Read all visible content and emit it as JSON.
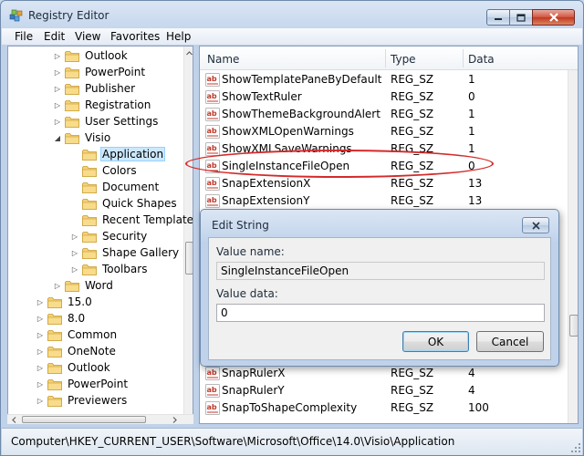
{
  "window": {
    "title": "Registry Editor",
    "controls": {
      "minimize_icon": "minimize-icon",
      "maximize_icon": "maximize-icon",
      "close_icon": "close-icon"
    }
  },
  "menu": [
    "File",
    "Edit",
    "View",
    "Favorites",
    "Help"
  ],
  "tree": {
    "items": [
      {
        "label": "Outlook",
        "depth": 2,
        "expander": "collapsed"
      },
      {
        "label": "PowerPoint",
        "depth": 2,
        "expander": "collapsed"
      },
      {
        "label": "Publisher",
        "depth": 2,
        "expander": "collapsed"
      },
      {
        "label": "Registration",
        "depth": 2,
        "expander": "collapsed"
      },
      {
        "label": "User Settings",
        "depth": 2,
        "expander": "collapsed"
      },
      {
        "label": "Visio",
        "depth": 2,
        "expander": "expanded"
      },
      {
        "label": "Application",
        "depth": 3,
        "expander": "none",
        "selected": true
      },
      {
        "label": "Colors",
        "depth": 3,
        "expander": "none"
      },
      {
        "label": "Document",
        "depth": 3,
        "expander": "none"
      },
      {
        "label": "Quick Shapes",
        "depth": 3,
        "expander": "none"
      },
      {
        "label": "Recent Templates",
        "depth": 3,
        "expander": "none"
      },
      {
        "label": "Security",
        "depth": 3,
        "expander": "collapsed"
      },
      {
        "label": "Shape Gallery",
        "depth": 3,
        "expander": "collapsed"
      },
      {
        "label": "Toolbars",
        "depth": 3,
        "expander": "collapsed"
      },
      {
        "label": "Word",
        "depth": 2,
        "expander": "collapsed"
      },
      {
        "label": "15.0",
        "depth": 1,
        "expander": "collapsed"
      },
      {
        "label": "8.0",
        "depth": 1,
        "expander": "collapsed"
      },
      {
        "label": "Common",
        "depth": 1,
        "expander": "collapsed"
      },
      {
        "label": "OneNote",
        "depth": 1,
        "expander": "collapsed"
      },
      {
        "label": "Outlook",
        "depth": 1,
        "expander": "collapsed"
      },
      {
        "label": "PowerPoint",
        "depth": 1,
        "expander": "collapsed"
      },
      {
        "label": "Previewers",
        "depth": 1,
        "expander": "collapsed"
      }
    ]
  },
  "values_list": {
    "columns": {
      "name": "Name",
      "type": "Type",
      "data": "Data"
    },
    "rows": [
      {
        "name": "ShowTemplatePaneByDefault",
        "type": "REG_SZ",
        "data": "1"
      },
      {
        "name": "ShowTextRuler",
        "type": "REG_SZ",
        "data": "0"
      },
      {
        "name": "ShowThemeBackgroundAlert",
        "type": "REG_SZ",
        "data": "1"
      },
      {
        "name": "ShowXMLOpenWarnings",
        "type": "REG_SZ",
        "data": "1"
      },
      {
        "name": "ShowXMLSaveWarnings",
        "type": "REG_SZ",
        "data": "1"
      },
      {
        "name": "SingleInstanceFileOpen",
        "type": "REG_SZ",
        "data": "0",
        "highlighted": true
      },
      {
        "name": "SnapExtensionX",
        "type": "REG_SZ",
        "data": "13"
      },
      {
        "name": "SnapExtensionY",
        "type": "REG_SZ",
        "data": "13"
      },
      {
        "name": "SnapRulerX",
        "type": "REG_SZ",
        "data": "4"
      },
      {
        "name": "SnapRulerY",
        "type": "REG_SZ",
        "data": "4"
      },
      {
        "name": "SnapToShapeComplexity",
        "type": "REG_SZ",
        "data": "100"
      }
    ],
    "value_icon": "string-value-icon",
    "highlight_color": "#d42a2a"
  },
  "dialog": {
    "title": "Edit String",
    "close_icon": "close-icon",
    "value_name_label": "Value name:",
    "value_name": "SingleInstanceFileOpen",
    "value_data_label": "Value data:",
    "value_data": "0",
    "ok_label": "OK",
    "cancel_label": "Cancel"
  },
  "status": {
    "path": "Computer\\HKEY_CURRENT_USER\\Software\\Microsoft\\Office\\14.0\\Visio\\Application"
  },
  "colors": {
    "selection_background": "#cce8ff",
    "window_frame": "#c6d7ed",
    "close_button": "#c0391f"
  }
}
